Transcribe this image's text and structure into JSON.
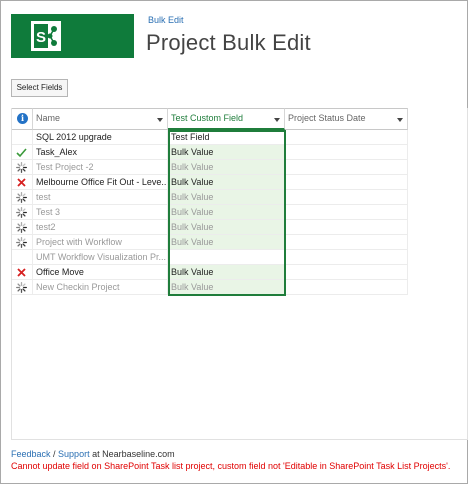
{
  "header": {
    "breadcrumb": "Bulk Edit",
    "title": "Project Bulk Edit",
    "brand_color": "#0f7b3b"
  },
  "toolbar": {
    "select_fields_label": "Select Fields"
  },
  "grid": {
    "columns": [
      {
        "label": ""
      },
      {
        "label": "Name"
      },
      {
        "label": "Test Custom Field"
      },
      {
        "label": "Project Status Date"
      }
    ],
    "rows": [
      {
        "status": "none",
        "name": "SQL 2012 upgrade",
        "custom": "Test Field",
        "date": "",
        "dim": false,
        "bulk": false
      },
      {
        "status": "check",
        "name": "Task_Alex",
        "custom": "Bulk Value",
        "date": "",
        "dim": false,
        "bulk": true
      },
      {
        "status": "spinner",
        "name": "Test Project -2",
        "custom": "Bulk Value",
        "date": "",
        "dim": true,
        "bulk": true
      },
      {
        "status": "error",
        "name": "Melbourne Office Fit Out - Leve...",
        "custom": "Bulk Value",
        "date": "",
        "dim": false,
        "bulk": true
      },
      {
        "status": "spinner",
        "name": "test",
        "custom": "Bulk Value",
        "date": "",
        "dim": true,
        "bulk": true
      },
      {
        "status": "spinner",
        "name": "Test 3",
        "custom": "Bulk Value",
        "date": "",
        "dim": true,
        "bulk": true
      },
      {
        "status": "spinner",
        "name": "test2",
        "custom": "Bulk Value",
        "date": "",
        "dim": true,
        "bulk": true
      },
      {
        "status": "spinner",
        "name": "Project with Workflow",
        "custom": "Bulk Value",
        "date": "",
        "dim": true,
        "bulk": true
      },
      {
        "status": "none",
        "name": "UMT Workflow Visualization Pr...",
        "custom": "",
        "date": "",
        "dim": true,
        "bulk": false
      },
      {
        "status": "error",
        "name": "Office Move",
        "custom": "Bulk Value",
        "date": "",
        "dim": false,
        "bulk": true
      },
      {
        "status": "spinner",
        "name": "New Checkin Project",
        "custom": "Bulk Value",
        "date": "",
        "dim": true,
        "bulk": true
      }
    ]
  },
  "footer": {
    "feedback_link": "Feedback",
    "separator": " / ",
    "support_link": "Support",
    "support_suffix": " at Nearbaseline.com",
    "error_message": "Cannot update field on SharePoint Task list project, custom field not 'Editable in SharePoint Task List Projects'.",
    "error_color": "#e00000"
  },
  "colors": {
    "accent": "#1f7d3b",
    "bulk_fill": "#e9f5e6",
    "link": "#2a6fb3"
  }
}
